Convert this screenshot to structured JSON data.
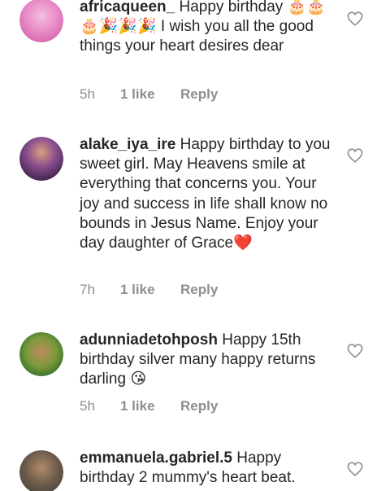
{
  "comments": [
    {
      "username": "africaqueen_",
      "text": " Happy birthday 🎂🎂🎂🎉🎉🎉 I wish you all the good things your heart desires dear",
      "time": "5h",
      "likes": "1 like",
      "reply": "Reply",
      "avatar_color": "#e98bc7"
    },
    {
      "username": "alake_iya_ire",
      "text": " Happy birthday to you sweet girl. May Heavens smile at everything that concerns you. Your joy and success in life shall know no bounds in Jesus Name. Enjoy your day daughter of Grace❤️",
      "time": "7h",
      "likes": "1 like",
      "reply": "Reply",
      "avatar_color": "#7a4a8c"
    },
    {
      "username": "adunniadetohposh",
      "text": " Happy 15th birthday silver many happy returns darling 😘",
      "time": "5h",
      "likes": "1 like",
      "reply": "Reply",
      "avatar_color": "#3f8a3a"
    },
    {
      "username": "emmanuela.gabriel.5",
      "text": " Happy birthday 2  mummy's heart beat.",
      "time": "",
      "likes": "",
      "reply": "",
      "avatar_color": "#6b5a4a"
    }
  ],
  "colors": {
    "text": "#262626",
    "meta": "#8e8e8e",
    "heart_outline": "#8e8e8e"
  },
  "icons": {
    "like": "heart-outline-icon"
  }
}
